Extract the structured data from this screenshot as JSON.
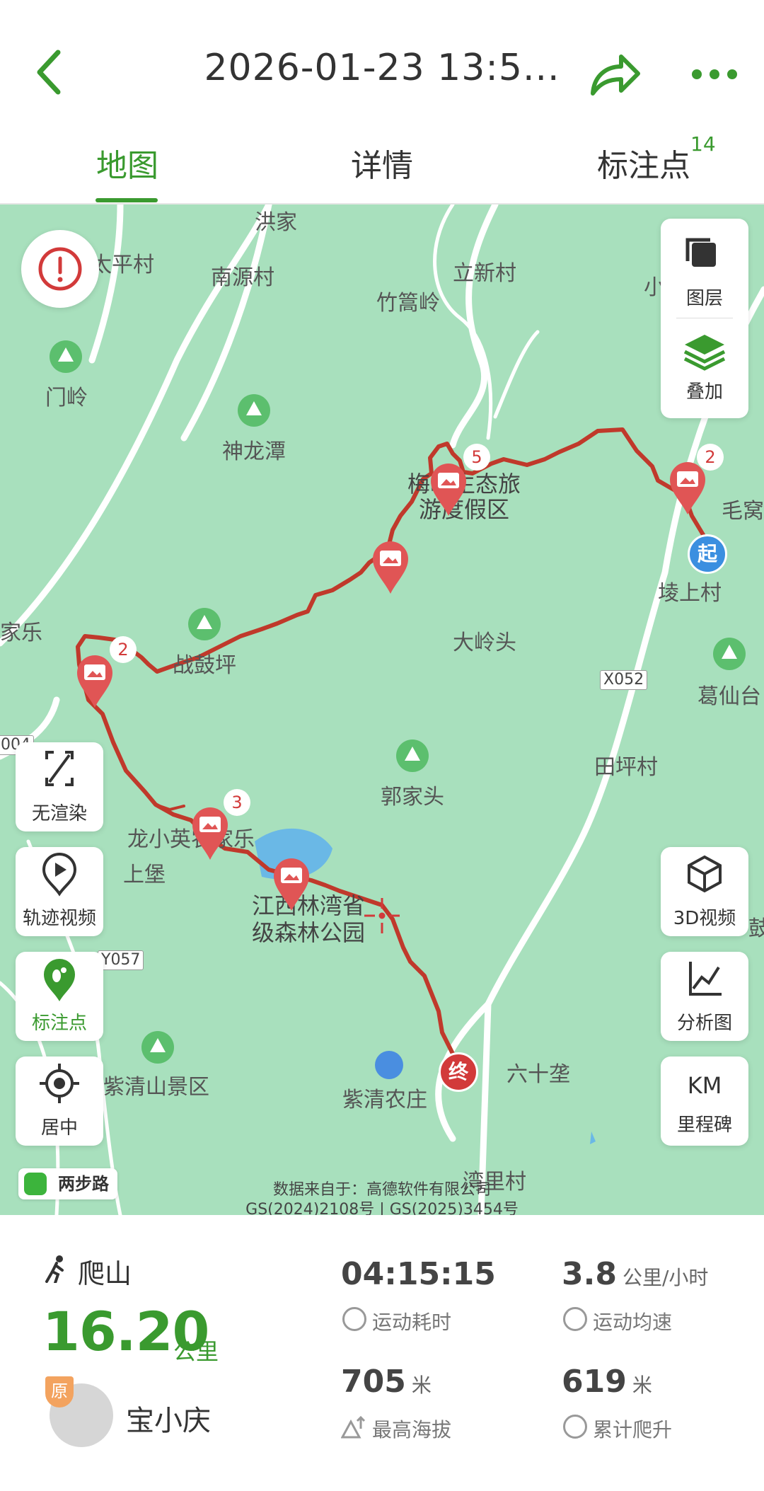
{
  "header": {
    "title": "2026-01-23 13:5...",
    "accent_color": "#3a9a2f"
  },
  "tabs": [
    {
      "label": "地图",
      "active": true
    },
    {
      "label": "详情",
      "active": false
    },
    {
      "label": "标注点",
      "active": false,
      "badge": "14"
    }
  ],
  "map": {
    "places": [
      "洪家",
      "太平村",
      "南源村",
      "立新村",
      "竹篙岭",
      "门岭",
      "神龙潭",
      "梅岭生态旅",
      "游度假区",
      "毛窝",
      "堎上村",
      "家乐",
      "战鼓坪",
      "大岭头",
      "葛仙台",
      "X052",
      "004",
      "田坪村",
      "郭家头",
      "龙小英农家乐",
      "上堡",
      "江西林湾省",
      "级森林公园",
      "3D视频",
      "Y057",
      "紫清山景区",
      "紫清农庄",
      "六十垄",
      "湾里村",
      "小",
      "鼓"
    ],
    "waypoint_counts": [
      "2",
      "5",
      "2",
      "3"
    ],
    "start_label": "起",
    "end_label": "终",
    "route_color": "#c0392b",
    "layers": {
      "layer_label": "图层",
      "overlay_label": "叠加"
    },
    "left_buttons": [
      "无渲染",
      "轨迹视频",
      "标注点",
      "居中"
    ],
    "right_buttons": [
      "3D视频",
      "分析图",
      "里程碑"
    ],
    "km_label": "KM",
    "twostep_label": "两步路",
    "attribution": [
      "数据来自于：高德软件有限公司",
      "GS(2024)2108号 | GS(2025)3454号"
    ]
  },
  "stats": {
    "sport": "爬山",
    "distance": "16.20",
    "distance_unit": "公里",
    "badge": "原",
    "username": "宝小庆",
    "duration": "04:15:15",
    "duration_label": "运动耗时",
    "avg_speed": "3.8",
    "avg_speed_unit": "公里/小时",
    "avg_speed_label": "运动均速",
    "max_alt": "705",
    "max_alt_unit": "米",
    "max_alt_label": "最高海拔",
    "climb": "619",
    "climb_unit": "米",
    "climb_label": "累计爬升"
  }
}
